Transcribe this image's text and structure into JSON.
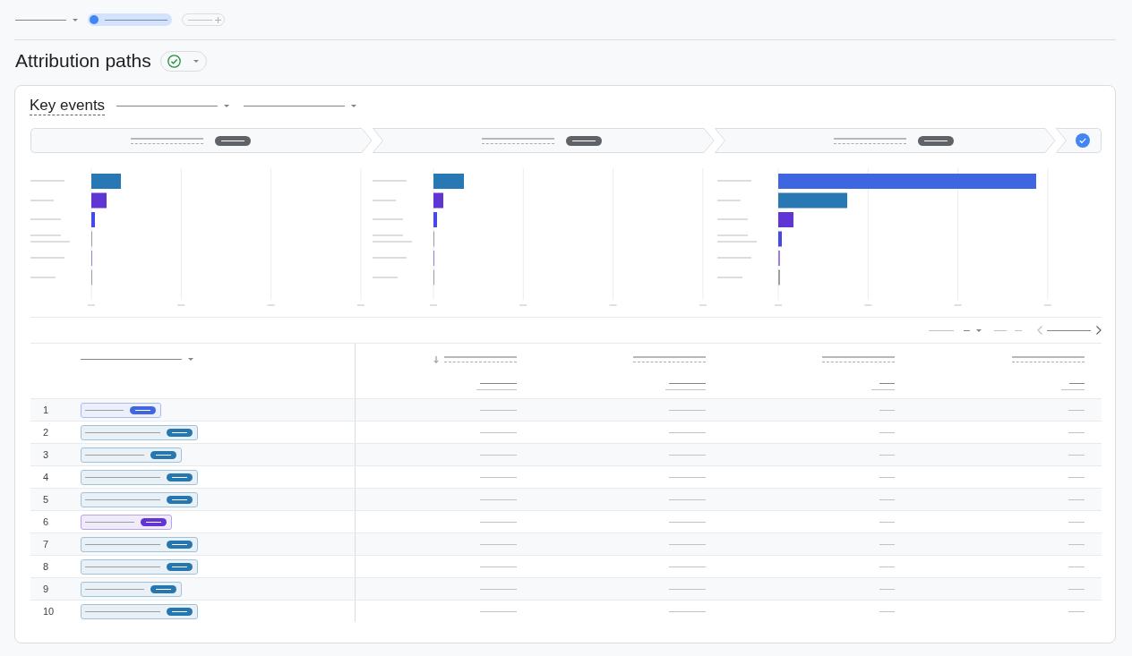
{
  "page_title": "Attribution paths",
  "card": {
    "metric_label": "Key events",
    "table": {
      "columns": [
        {
          "sorted": true
        },
        {
          "sorted": false
        },
        {
          "sorted": false
        },
        {
          "sorted": false
        }
      ],
      "rows": [
        {
          "rank": "1",
          "color": "#3f65e0"
        },
        {
          "rank": "2",
          "color": "#2677b0"
        },
        {
          "rank": "3",
          "color": "#2677b0"
        },
        {
          "rank": "4",
          "color": "#2677b0"
        },
        {
          "rank": "5",
          "color": "#2677b0"
        },
        {
          "rank": "6",
          "color": "#6134d3"
        },
        {
          "rank": "7",
          "color": "#2677b0"
        },
        {
          "rank": "8",
          "color": "#2677b0"
        },
        {
          "rank": "9",
          "color": "#2677b0"
        },
        {
          "rank": "10",
          "color": "#2677b0"
        }
      ]
    }
  }
}
